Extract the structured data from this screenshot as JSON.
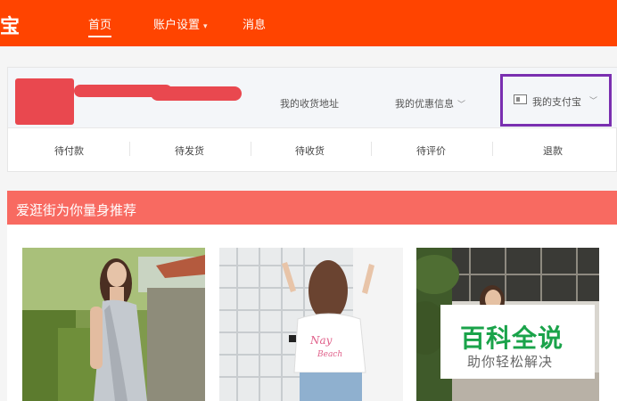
{
  "topbar": {
    "logo_fragment": "宝",
    "nav": [
      {
        "label": "首页"
      },
      {
        "label": "账户设置"
      },
      {
        "label": "消息"
      }
    ]
  },
  "user_panel": {
    "links": {
      "address": "我的收货地址",
      "coupons": "我的优惠信息",
      "alipay": "我的支付宝"
    },
    "order_tabs": [
      "待付款",
      "待发货",
      "待收货",
      "待评价",
      "退款"
    ]
  },
  "recommend": {
    "title": "爱逛街为你量身推荐"
  },
  "watermark": {
    "title": "百科全说",
    "subtitle": "助你轻松解决"
  },
  "colors": {
    "topbar": "#ff4400",
    "recommend_header": "#f86a61",
    "highlight_box": "#7a2fb0",
    "redaction": "#e9484f",
    "watermark_green": "#1aa34a"
  }
}
